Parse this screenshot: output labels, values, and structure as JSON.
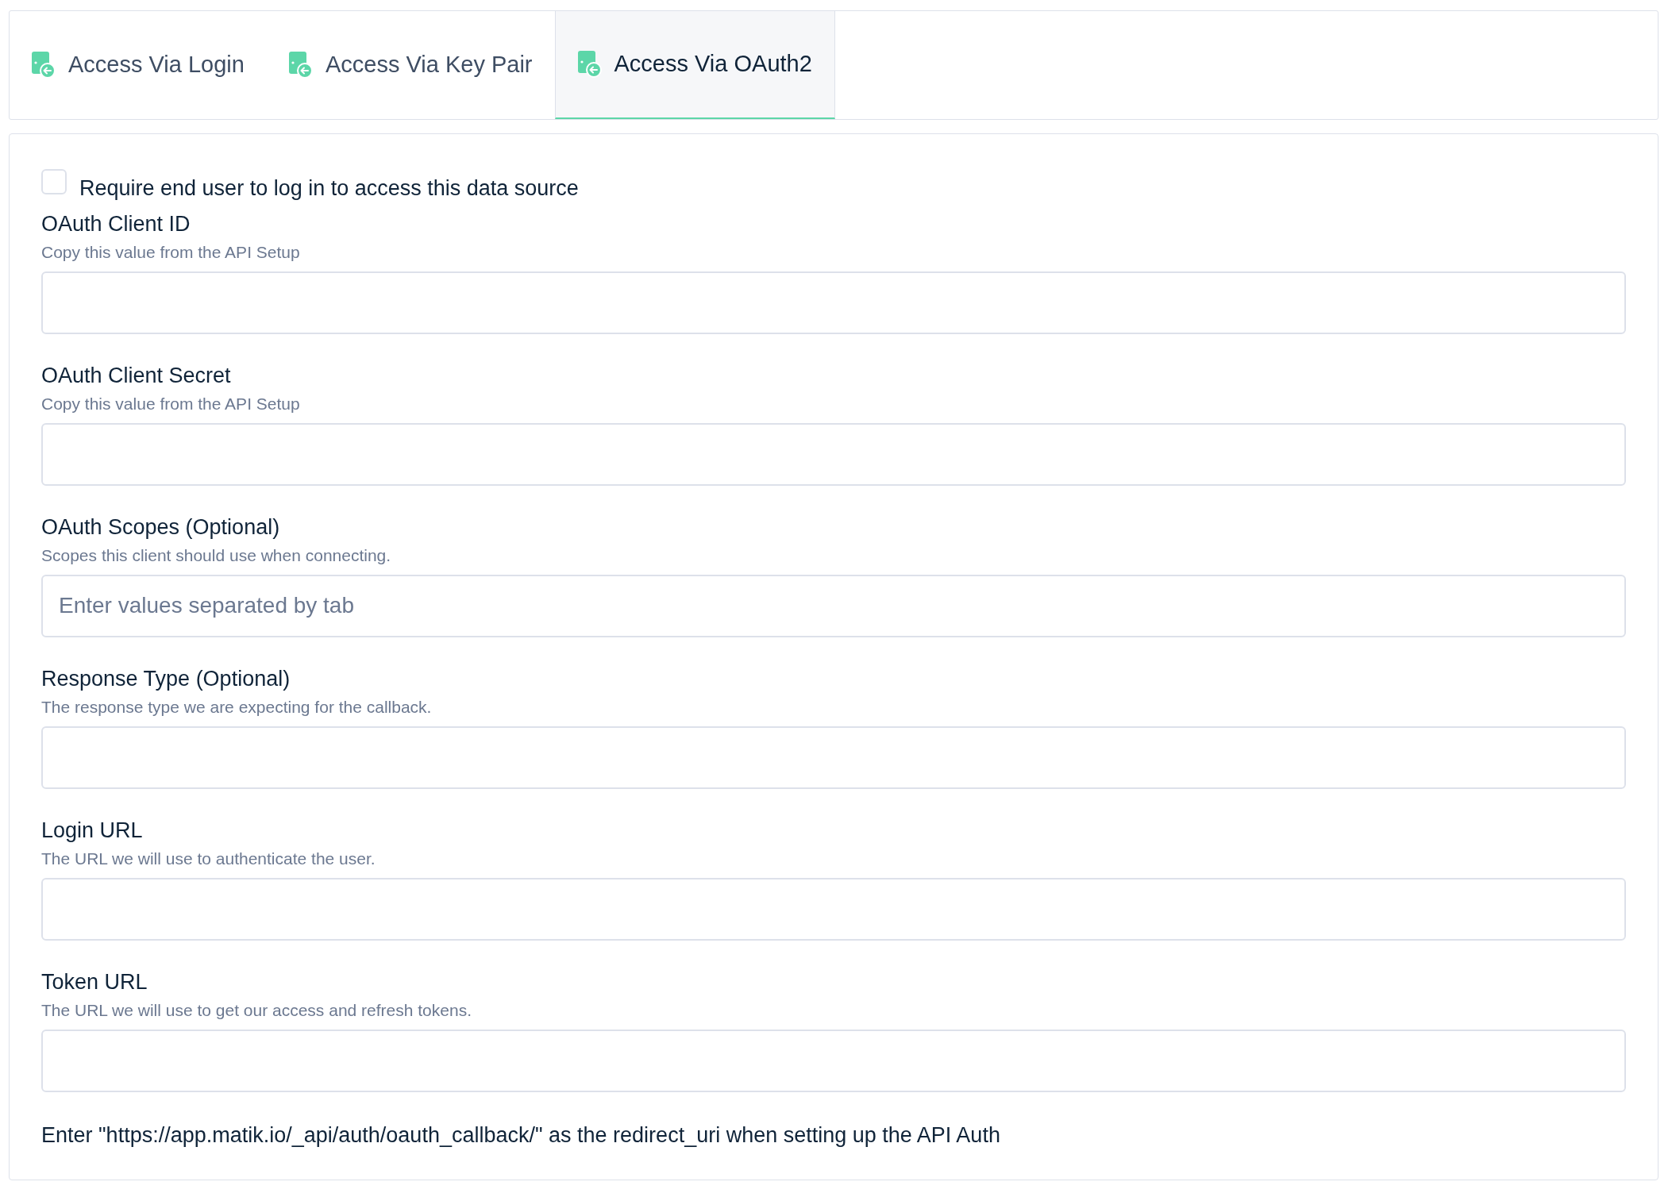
{
  "tabs": [
    {
      "label": "Access Via Login",
      "selected": false
    },
    {
      "label": "Access Via Key Pair",
      "selected": false
    },
    {
      "label": "Access Via OAuth2",
      "selected": true
    }
  ],
  "require_login": {
    "label": "Require end user to log in to access this data source",
    "checked": false
  },
  "fields": [
    {
      "label": "OAuth Client ID",
      "help": "Copy this value from the API Setup"
    },
    {
      "label": "OAuth Client Secret",
      "help": "Copy this value from the API Setup"
    },
    {
      "label": "OAuth Scopes (Optional)",
      "help": "Scopes this client should use when connecting.",
      "placeholder": "Enter values separated by tab"
    },
    {
      "label": "Response Type (Optional)",
      "help": "The response type we are expecting for the callback."
    },
    {
      "label": "Login URL",
      "help": "The URL we will use to authenticate the user."
    },
    {
      "label": "Token URL",
      "help": "The URL we will use to get our access and refresh tokens."
    }
  ],
  "note": "Enter \"https://app.matik.io/_api/auth/oauth_callback/\" as the redirect_uri when setting up the API Auth"
}
